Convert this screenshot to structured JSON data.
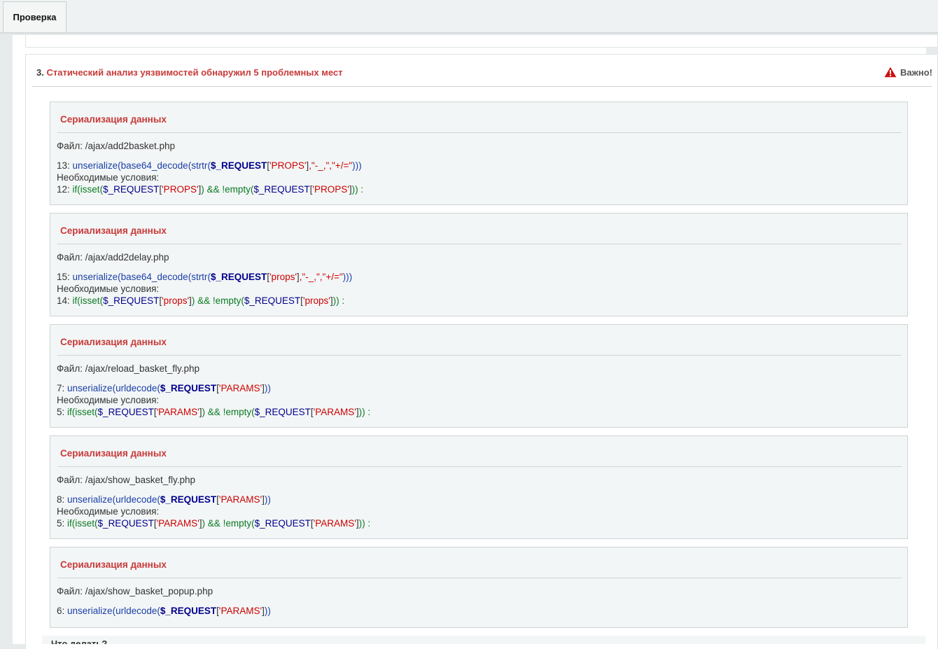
{
  "tabs": [
    {
      "label": "Проверка"
    }
  ],
  "section": {
    "number": "3.",
    "title": "Статический анализ уязвимостей обнаружил 5 проблемных мест",
    "badge_label": "Важно!",
    "badge_icon": "warning-triangle-icon",
    "badge_color": "#cc1111",
    "title_color": "#c83a3a"
  },
  "findings": [
    {
      "title": "Сериализация данных",
      "file": "Файл: /ajax/add2basket.php",
      "line_no": "13:",
      "request_key": "'PROPS'",
      "strtr_args": ",\"-_,\",\"+/=\"",
      "has_conditions": true,
      "conditions_label": "Необходимые условия:",
      "cond_line_no": "12:"
    },
    {
      "title": "Сериализация данных",
      "file": "Файл: /ajax/add2delay.php",
      "line_no": "15:",
      "request_key": "'props'",
      "strtr_args": ",\"-_,\",\"+/=\"",
      "has_conditions": true,
      "conditions_label": "Необходимые условия:",
      "cond_line_no": "14:"
    },
    {
      "title": "Сериализация данных",
      "file": "Файл: /ajax/reload_basket_fly.php",
      "line_no": "7:",
      "request_key": "'PARAMS'",
      "has_conditions": true,
      "conditions_label": "Необходимые условия:",
      "cond_line_no": "5:"
    },
    {
      "title": "Сериализация данных",
      "file": "Файл: /ajax/show_basket_fly.php",
      "line_no": "8:",
      "request_key": "'PARAMS'",
      "has_conditions": true,
      "conditions_label": "Необходимые условия:",
      "cond_line_no": "5:"
    },
    {
      "title": "Сериализация данных",
      "file": "Файл: /ajax/show_basket_popup.php",
      "line_no": "6:",
      "request_key": "'PARAMS'",
      "has_conditions": false
    }
  ],
  "code_tokens": {
    "unserialize": "unserialize",
    "base64_decode": "base64_decode",
    "strtr": "strtr",
    "urldecode": "urldecode",
    "request_var": "$_REQUEST",
    "if_kw": "if",
    "isset_kw": "isset",
    "empty_kw": "empty",
    "and_op": "&&",
    "not_op": "!",
    "colon": ":"
  },
  "footer_text": "Что делать?"
}
